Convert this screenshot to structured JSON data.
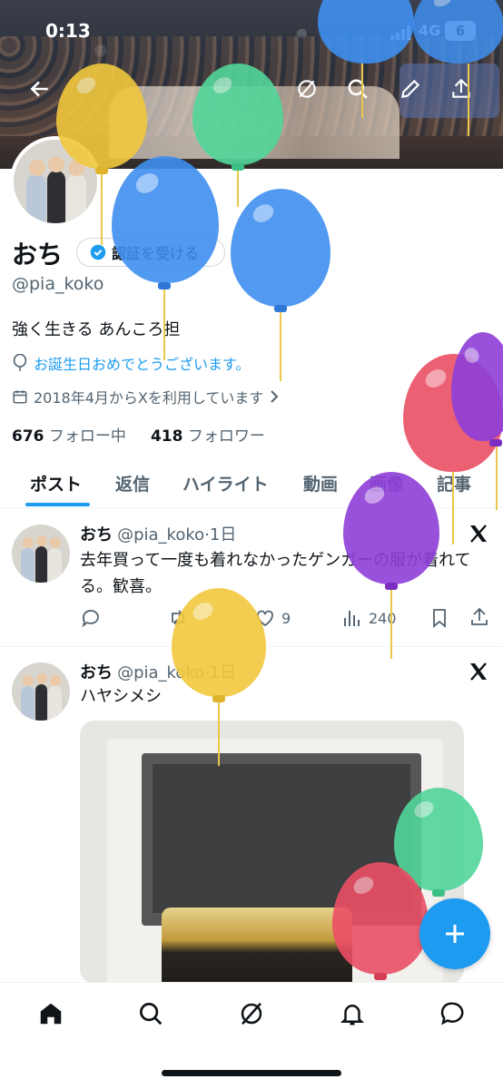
{
  "status_bar": {
    "time": "0:13",
    "network": "4G",
    "battery": "6"
  },
  "profile": {
    "name": "おち",
    "verify_label": "認証を受ける",
    "handle": "@pia_koko",
    "bio": "強く生きる あんころ担",
    "birthday": "お誕生日おめでとうございます。",
    "joined": "2018年4月からXを利用しています",
    "following_count": "676",
    "following_label": "フォロー中",
    "followers_count": "418",
    "followers_label": "フォロワー"
  },
  "tabs": [
    "ポスト",
    "返信",
    "ハイライト",
    "動画",
    "画像",
    "記事"
  ],
  "posts": [
    {
      "name": "おち",
      "meta": "@pia_koko·1日",
      "text": "去年買って一度も着れなかったゲンガーの服が着れてる。歓喜。",
      "likes": "9",
      "views": "240"
    },
    {
      "name": "おち",
      "meta": "@pia_koko·1日",
      "text": "ハヤシメシ"
    }
  ],
  "colors": {
    "accent": "#1d9bf0",
    "text": "#0f1419",
    "secondary": "#536471"
  },
  "icons": [
    "back-icon",
    "grok-icon",
    "search-icon",
    "edit-icon",
    "share-icon",
    "verified-icon",
    "balloon-icon",
    "calendar-icon",
    "reply-icon",
    "repost-icon",
    "like-icon",
    "views-icon",
    "bookmark-icon",
    "x-logo-icon",
    "home-icon",
    "notifications-icon",
    "messages-icon",
    "plus-icon"
  ]
}
